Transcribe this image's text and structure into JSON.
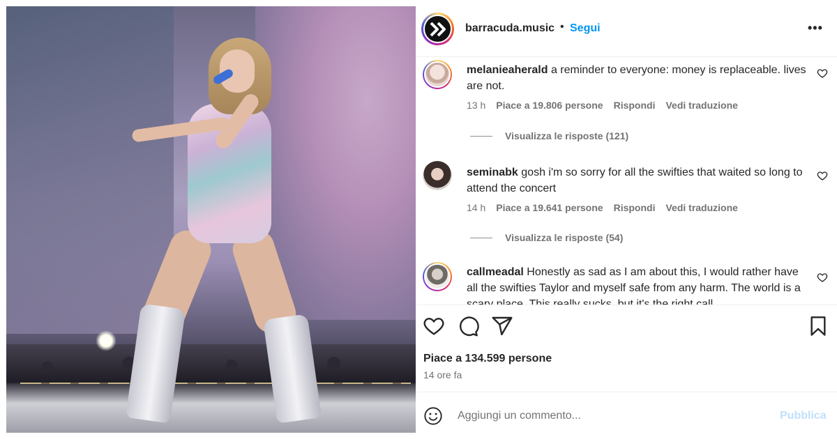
{
  "post": {
    "account": "barracuda.music",
    "separator": "•",
    "follow_label": "Segui",
    "more_label": "•••",
    "image_alt": "Performer in a sparkling bodysuit and silver boots singing into a blue microphone on stage"
  },
  "comments": [
    {
      "username": "melanieaherald",
      "text": "a reminder to everyone: money is replaceable. lives are not.",
      "time": "13 h",
      "likes": "Piace a 19.806 persone",
      "reply": "Rispondi",
      "translate": "Vedi traduzione",
      "view_replies": "Visualizza le risposte (121)",
      "avatar_ring": true,
      "avatar_color": "#e8d7d2"
    },
    {
      "username": "seminabk",
      "text": "gosh i'm so sorry for all the swifties that waited so long to attend the concert",
      "time": "14 h",
      "likes": "Piace a 19.641 persone",
      "reply": "Rispondi",
      "translate": "Vedi traduzione",
      "view_replies": "Visualizza le risposte (54)",
      "avatar_ring": false,
      "avatar_color": "#5a4a44"
    },
    {
      "username": "callmeadal",
      "text": "Honestly as sad as I am about this, I would rather have all the swifties Taylor and myself safe from any harm. The world is a scary place. This really sucks, but it's the right call",
      "avatar_ring": true,
      "avatar_color": "#c9c6c2"
    }
  ],
  "actions": {
    "like_icon": "heart-icon",
    "comment_icon": "comment-icon",
    "share_icon": "share-icon",
    "save_icon": "bookmark-icon",
    "likes_text": "Piace a 134.599 persone",
    "date_text": "14 ore fa"
  },
  "add_comment": {
    "emoji_icon": "emoji-icon",
    "placeholder": "Aggiungi un commento...",
    "publish_label": "Pubblica"
  },
  "colors": {
    "link_blue": "#0095f6",
    "publish_disabled": "#c0dffd",
    "muted_text": "#737373"
  }
}
